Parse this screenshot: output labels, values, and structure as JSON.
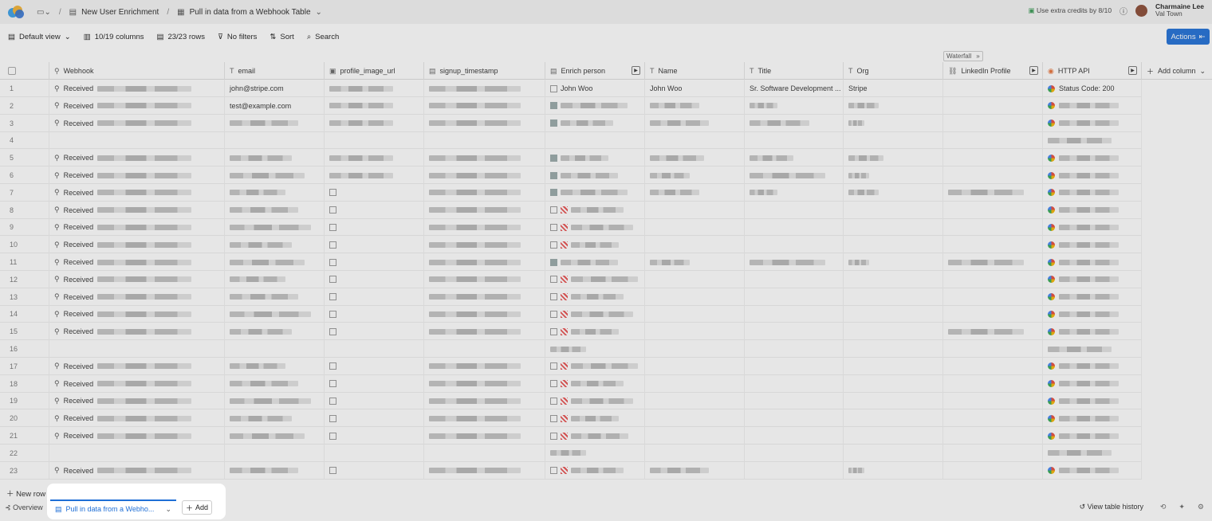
{
  "breadcrumb": {
    "folder_label": "",
    "workbook": "New User Enrichment",
    "table": "Pull in data from a Webhook Table"
  },
  "topbar": {
    "credits": "Use extra credits by 8/10",
    "user_name": "Charmaine Lee",
    "user_org": "Val Town"
  },
  "toolbar": {
    "view": "Default view",
    "columns": "10/19 columns",
    "rows": "23/23 rows",
    "filters": "No filters",
    "sort": "Sort",
    "search": "Search",
    "actions": "Actions"
  },
  "waterfall": "Waterfall",
  "columns": [
    {
      "label": "Webhook"
    },
    {
      "label": "email"
    },
    {
      "label": "profile_image_url"
    },
    {
      "label": "signup_timestamp"
    },
    {
      "label": "Enrich person"
    },
    {
      "label": "Name"
    },
    {
      "label": "Title"
    },
    {
      "label": "Org"
    },
    {
      "label": "LinkedIn Profile"
    },
    {
      "label": "HTTP API"
    }
  ],
  "add_column": "Add column",
  "rows": [
    {
      "n": "1",
      "webhook": "Received",
      "email": "john@stripe.com",
      "enrich": "John Woo",
      "name": "John Woo",
      "title": "Sr. Software Development ...",
      "org": "Stripe",
      "http": "Status Code: 200"
    },
    {
      "n": "2",
      "webhook": "Received",
      "email": "test@example.com"
    },
    {
      "n": "3",
      "webhook": "Received"
    },
    {
      "n": "4",
      "webhook": ""
    },
    {
      "n": "5",
      "webhook": "Received"
    },
    {
      "n": "6",
      "webhook": "Received"
    },
    {
      "n": "7",
      "webhook": "Received"
    },
    {
      "n": "8",
      "webhook": "Received"
    },
    {
      "n": "9",
      "webhook": "Received"
    },
    {
      "n": "10",
      "webhook": "Received"
    },
    {
      "n": "11",
      "webhook": "Received"
    },
    {
      "n": "12",
      "webhook": "Received"
    },
    {
      "n": "13",
      "webhook": "Received"
    },
    {
      "n": "14",
      "webhook": "Received"
    },
    {
      "n": "15",
      "webhook": "Received"
    },
    {
      "n": "16",
      "webhook": ""
    },
    {
      "n": "17",
      "webhook": "Received"
    },
    {
      "n": "18",
      "webhook": "Received"
    },
    {
      "n": "19",
      "webhook": "Received"
    },
    {
      "n": "20",
      "webhook": "Received"
    },
    {
      "n": "21",
      "webhook": "Received"
    },
    {
      "n": "22",
      "webhook": ""
    },
    {
      "n": "23",
      "webhook": "Received"
    }
  ],
  "bottom": {
    "new_row": "New row",
    "overview": "Overview",
    "tab": "Pull in data from a Webho...",
    "add": "Add",
    "history": "View table history"
  },
  "colors": {
    "accent": "#1f6fd6"
  }
}
